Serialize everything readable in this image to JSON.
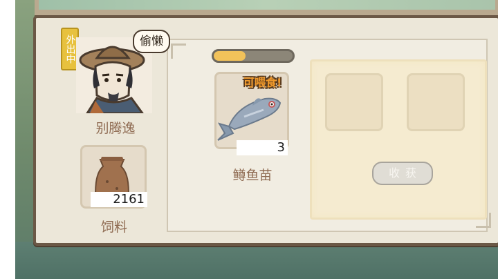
{
  "character": {
    "status_badge": "外出中",
    "thought": "偷懒",
    "name": "别腾逸"
  },
  "feed": {
    "count": "2161",
    "label": "饲料"
  },
  "fish": {
    "progress": 0.4,
    "notice": "可喂食!",
    "count": "3",
    "label": "鳟鱼苗"
  },
  "harvest": {
    "button_label": "收获",
    "slots": [
      {},
      {}
    ]
  },
  "icons": [
    "character-portrait",
    "feed-bag-icon",
    "fish-icon"
  ],
  "colors": {
    "progress_fill": "#f2c25a",
    "label_brown": "#8f6b52",
    "notice_orange": "#f29a2b",
    "badge_yellow": "#e7c13e"
  }
}
